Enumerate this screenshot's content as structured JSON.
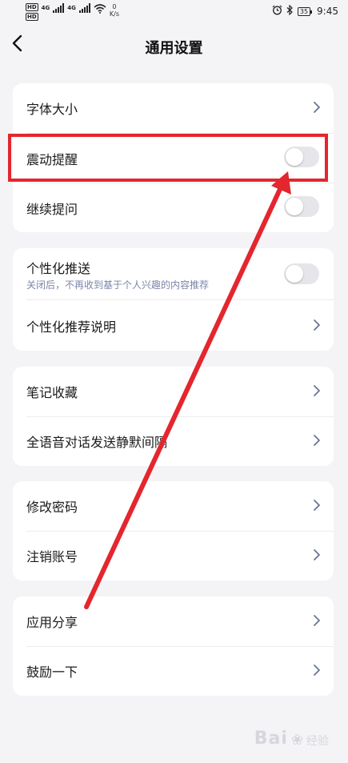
{
  "status_bar": {
    "hd1": "HD",
    "hd2": "HD",
    "net1": "4G",
    "net2": "4G",
    "speed_value": "0",
    "speed_unit": "K/s",
    "battery": "35",
    "time": "9:45"
  },
  "header": {
    "title": "通用设置"
  },
  "groups": [
    {
      "rows": [
        {
          "label": "字体大小",
          "control": "chevron"
        },
        {
          "label": "震动提醒",
          "control": "toggle",
          "on": false
        },
        {
          "label": "继续提问",
          "control": "toggle",
          "on": false
        }
      ]
    },
    {
      "rows": [
        {
          "label": "个性化推送",
          "subtitle": "关闭后，不再收到基于个人兴趣的内容推荐",
          "control": "toggle",
          "on": false
        },
        {
          "label": "个性化推荐说明",
          "control": "chevron"
        }
      ]
    },
    {
      "rows": [
        {
          "label": "笔记收藏",
          "control": "chevron"
        },
        {
          "label": "全语音对话发送静默间隔",
          "control": "chevron"
        }
      ]
    },
    {
      "rows": [
        {
          "label": "修改密码",
          "control": "chevron"
        },
        {
          "label": "注销账号",
          "control": "chevron"
        }
      ]
    },
    {
      "rows": [
        {
          "label": "应用分享",
          "control": "chevron"
        },
        {
          "label": "鼓励一下",
          "control": "chevron"
        }
      ]
    }
  ],
  "annotation": {
    "color": "#e4262e",
    "target_row": "震动提醒"
  },
  "watermark": {
    "brand": "Bai",
    "text": "经验"
  },
  "colors": {
    "background": "#f4f4f7",
    "card": "#ffffff",
    "subtitle": "#7c86a8",
    "chevron": "#6b7591",
    "toggle_off": "#e6e6ea"
  }
}
